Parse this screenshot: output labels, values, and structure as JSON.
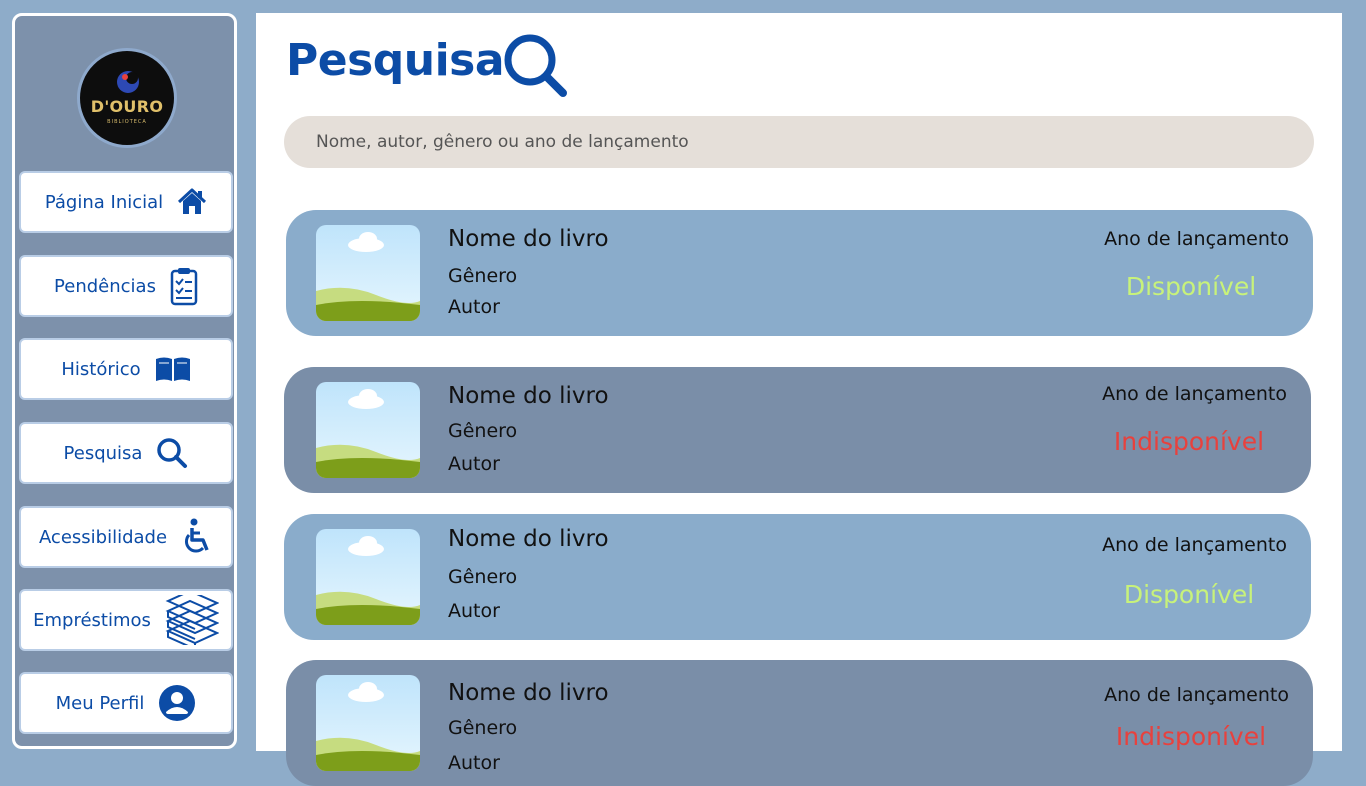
{
  "app": {
    "logo_title": "D'OURO",
    "logo_subtitle": "BIBLIOTECA"
  },
  "sidebar": {
    "items": [
      {
        "label": "Página Inicial",
        "icon": "home-icon"
      },
      {
        "label": "Pendências",
        "icon": "clipboard-icon"
      },
      {
        "label": "Histórico",
        "icon": "book-open-icon"
      },
      {
        "label": "Pesquisa",
        "icon": "search-icon"
      },
      {
        "label": "Acessibilidade",
        "icon": "wheelchair-icon"
      },
      {
        "label": "Empréstimos",
        "icon": "books-stack-icon"
      },
      {
        "label": "Meu Perfil",
        "icon": "user-icon"
      }
    ]
  },
  "main": {
    "title": "Pesquisa",
    "search_placeholder": "Nome, autor, gênero ou ano de lançamento",
    "books": [
      {
        "name": "Nome do livro",
        "genre": "Gênero",
        "author": "Autor",
        "year": "Ano de lançamento",
        "status": "Disponível"
      },
      {
        "name": "Nome do livro",
        "genre": "Gênero",
        "author": "Autor",
        "year": "Ano de lançamento",
        "status": "Indisponível"
      },
      {
        "name": "Nome do livro",
        "genre": "Gênero",
        "author": "Autor",
        "year": "Ano de lançamento",
        "status": "Disponível"
      },
      {
        "name": "Nome do livro",
        "genre": "Gênero",
        "author": "Autor",
        "year": "Ano de lançamento",
        "status": "Indisponível"
      }
    ]
  },
  "colors": {
    "accent": "#0c4ca6",
    "available": "#c8f27a",
    "unavailable": "#e8413d",
    "card_light": "#8aaccb",
    "card_dark": "#7a8ea8"
  }
}
